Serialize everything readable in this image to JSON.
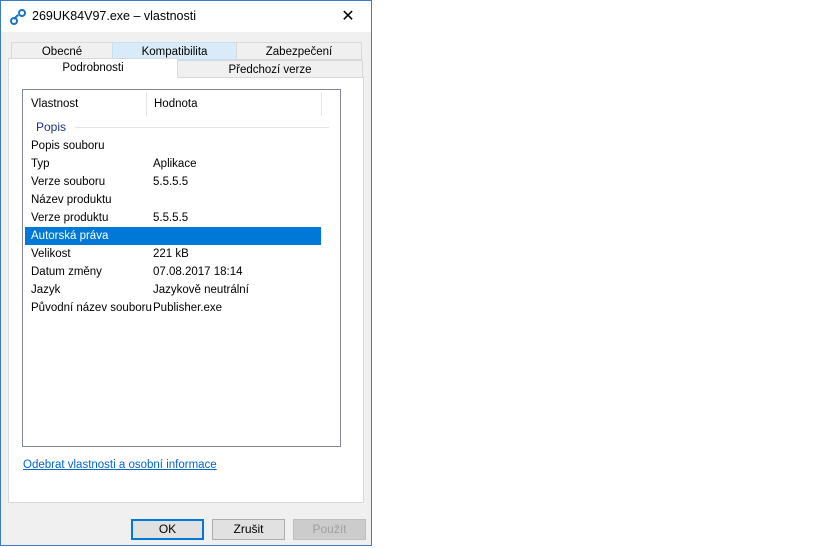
{
  "window": {
    "title": "269UK84V97.exe – vlastnosti",
    "close_glyph": "✕"
  },
  "tabs_row1": [
    {
      "label": "Obecné"
    },
    {
      "label": "Kompatibilita"
    },
    {
      "label": "Zabezpečení"
    }
  ],
  "tabs_row2": [
    {
      "label": "Podrobnosti"
    },
    {
      "label": "Předchozí verze"
    }
  ],
  "list": {
    "headers": [
      "Vlastnost",
      "Hodnota"
    ],
    "group": "Popis",
    "rows": [
      {
        "key": "Popis souboru",
        "value": ""
      },
      {
        "key": "Typ",
        "value": "Aplikace"
      },
      {
        "key": "Verze souboru",
        "value": "5.5.5.5"
      },
      {
        "key": "Název produktu",
        "value": ""
      },
      {
        "key": "Verze produktu",
        "value": "5.5.5.5"
      },
      {
        "key": "Autorská práva",
        "value": ""
      },
      {
        "key": "Velikost",
        "value": "221 kB"
      },
      {
        "key": "Datum změny",
        "value": "07.08.2017 18:14"
      },
      {
        "key": "Jazyk",
        "value": "Jazykově neutrální"
      },
      {
        "key": "Původní název souboru",
        "value": "Publisher.exe"
      }
    ],
    "selected_row": "Autorská práva"
  },
  "link_text": "Odebrat vlastnosti a osobní informace",
  "buttons": {
    "ok": "OK",
    "cancel": "Zrušit",
    "apply": "Použít"
  },
  "colors": {
    "accent": "#0078d7",
    "link": "#0066cc",
    "group": "#1e3287"
  }
}
